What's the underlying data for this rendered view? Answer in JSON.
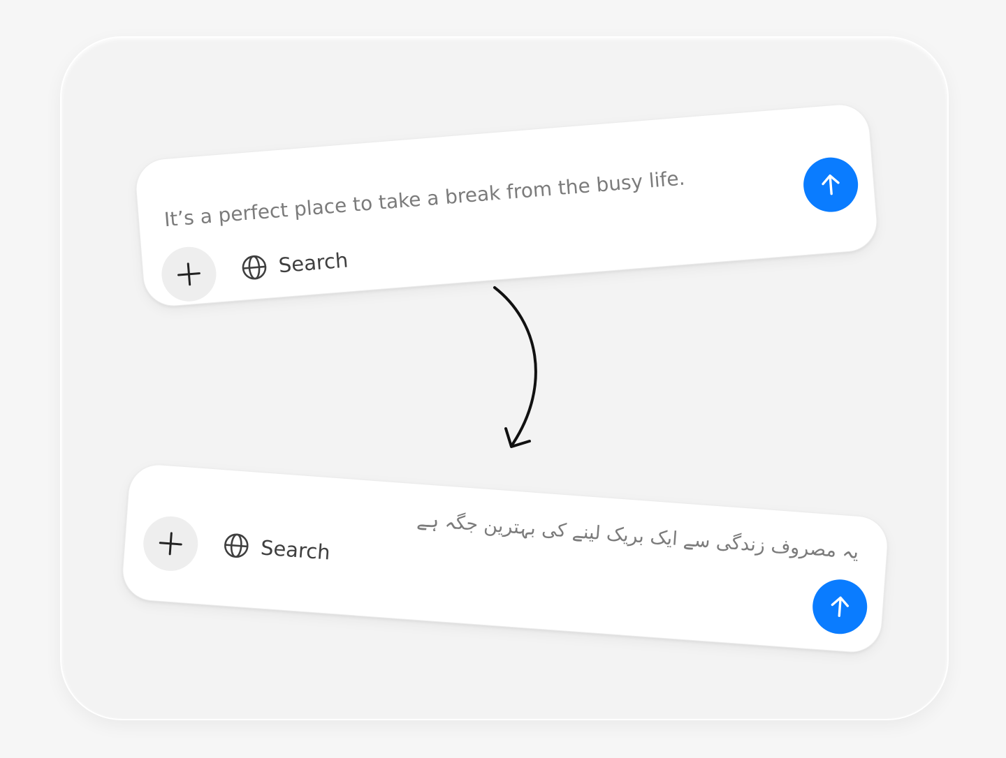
{
  "colors": {
    "accent": "#0a7cff",
    "card_background": "#ffffff",
    "frame_background": "#f3f3f3",
    "plus_button_background": "#eeeeee",
    "prompt_text": "#7b7b7b"
  },
  "cards": [
    {
      "prompt_text": "It’s a perfect place to take a break from the busy life.",
      "plus_icon": "plus-icon",
      "search_icon": "globe-icon",
      "search_label": "Search",
      "send_icon": "arrow-up-icon"
    },
    {
      "prompt_text": "یہ مصروف زندگی سے ایک بریک لینے کی بہترین جگہ ہے",
      "plus_icon": "plus-icon",
      "search_icon": "globe-icon",
      "search_label": "Search",
      "send_icon": "arrow-up-icon"
    }
  ],
  "connector_icon": "curved-arrow-down-icon"
}
